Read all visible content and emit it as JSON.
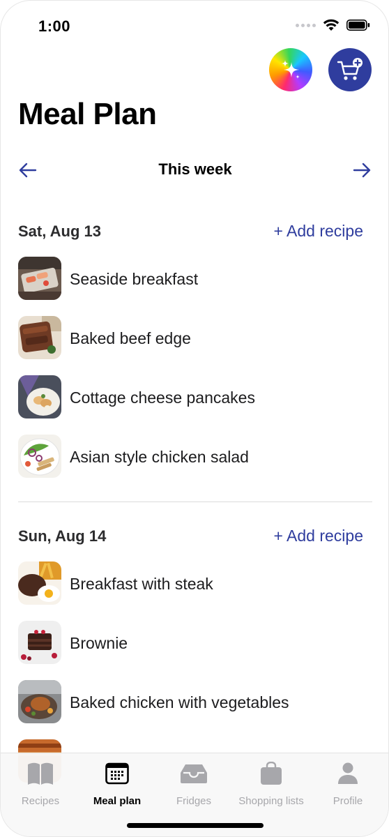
{
  "status_bar": {
    "time": "1:00"
  },
  "header": {
    "title": "Meal Plan",
    "magic_button_icon": "sparkles-icon",
    "cart_button_icon": "cart-add-icon"
  },
  "week_nav": {
    "label": "This week",
    "prev_icon": "arrow-left-icon",
    "next_icon": "arrow-right-icon"
  },
  "days": [
    {
      "title": "Sat, Aug 13",
      "add_label": "+ Add recipe",
      "recipes": [
        {
          "name": "Seaside breakfast"
        },
        {
          "name": "Baked beef edge"
        },
        {
          "name": "Cottage cheese pancakes"
        },
        {
          "name": "Asian style chicken salad"
        }
      ]
    },
    {
      "title": "Sun, Aug 14",
      "add_label": "+ Add recipe",
      "recipes": [
        {
          "name": "Breakfast with steak"
        },
        {
          "name": "Brownie"
        },
        {
          "name": "Baked chicken with vegetables"
        }
      ]
    }
  ],
  "tab_bar": {
    "tabs": [
      {
        "label": "Recipes",
        "icon": "book-icon",
        "active": false
      },
      {
        "label": "Meal plan",
        "icon": "calendar-icon",
        "active": true
      },
      {
        "label": "Fridges",
        "icon": "fridge-tray-icon",
        "active": false
      },
      {
        "label": "Shopping lists",
        "icon": "shopping-bag-icon",
        "active": false
      },
      {
        "label": "Profile",
        "icon": "person-icon",
        "active": false
      }
    ]
  },
  "colors": {
    "accent": "#2f3d9e",
    "inactive_tab": "#a7a7ab"
  }
}
